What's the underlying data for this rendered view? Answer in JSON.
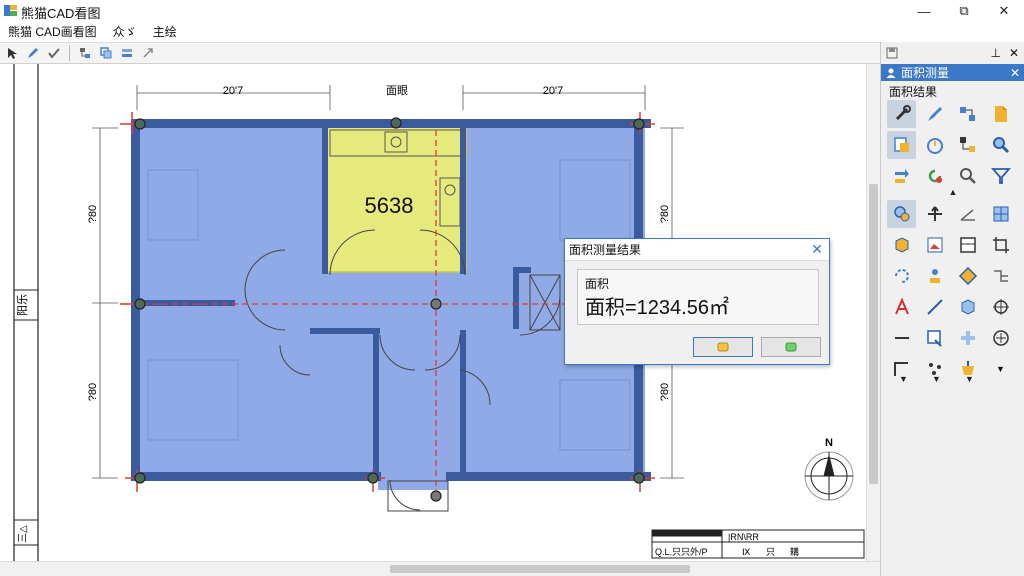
{
  "window": {
    "title": "熊猫CAD看图",
    "min_glyph": "—",
    "max_glyph": "⧉",
    "close_glyph": "✕"
  },
  "menu": [
    "熊猫 CAD画看图",
    "众ゞ",
    "主绘"
  ],
  "drawing": {
    "dim_top_left": "20'7",
    "dim_top_center": "面眼",
    "dim_top_right": "20'7",
    "dim_left_upper": "?80",
    "dim_left_lower": "?80",
    "dim_right_upper": "?80",
    "dim_right_lower": "?80",
    "side_label_upper": "阳乐",
    "side_label_lower": "三△",
    "room_area": "5638",
    "north": "N",
    "title_block": {
      "cell_a": "|RN\\RR",
      "row": [
        "Q.L.只只外/P",
        "Ⅸ",
        "只",
        "耩"
      ]
    },
    "colors": {
      "floor": "#8faae6",
      "wall": "#3c5b9e",
      "kitchen": "#e6ea7c",
      "axis": "#e03a3a"
    }
  },
  "dialog": {
    "title": "面积测量结果",
    "close_glyph": "✕",
    "label": "面积",
    "value": "面积=1234.56㎡"
  },
  "panel": {
    "pin_glyph": "⊥",
    "close_glyph": "✕",
    "header": "面积测量",
    "subheader": "面积结果",
    "toggle_up": "▲",
    "toggle_more": "▼"
  },
  "accent": "#3c78c8"
}
